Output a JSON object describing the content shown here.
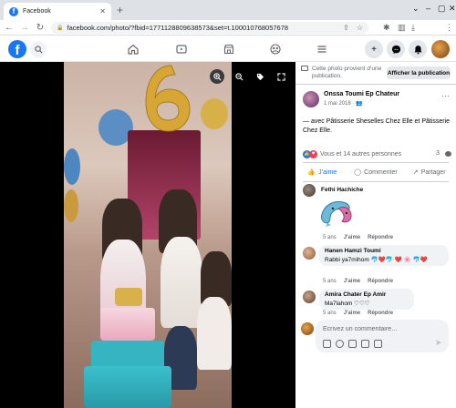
{
  "browser": {
    "tab_title": "Facebook",
    "url": "facebook.com/photo/?fbid=1771128809638573&set=t.100010768057678",
    "icons": [
      "back-icon",
      "forward-icon",
      "reload-icon",
      "lock-icon",
      "share-icon",
      "star-icon",
      "extensions-icon",
      "sidebar-icon",
      "download-icon",
      "profile-icon",
      "more-icon"
    ]
  },
  "facebook_bar": {
    "logo": "f",
    "nav_icons": [
      "home-icon",
      "watch-icon",
      "marketplace-icon",
      "groups-icon",
      "menu-icon"
    ],
    "right_icons": [
      "create-icon",
      "messenger-icon",
      "notifications-icon",
      "account-icon"
    ]
  },
  "panel": {
    "notice": "Cette photo provient d’une publication.",
    "publish_button": "Afficher la publication",
    "author": "Onssa Toumi Ep Chateur",
    "date": "1 mai 2018 ·",
    "caption": "— avec Pâtisserie Sheselles Chez Elle et Pâtisserie Chez Elle.",
    "reactions_text": "Vous et 14 autres personnes",
    "comment_count": "3",
    "actions": {
      "like": "J’aime",
      "comment": "Commenter",
      "share": "Partager"
    },
    "comments": [
      {
        "name": "Fethi Hachiche",
        "text": "",
        "sticker": true,
        "time": "5 ans",
        "like": "J'aime",
        "reply": "Répondre"
      },
      {
        "name": "Hanen Hamzi Toumi",
        "text": "Rabbi ya7mihom 🐬❤️🐬 ❤️ 🌸 🐬❤️",
        "time": "5 ans",
        "like": "J'aime",
        "reply": "Répondre"
      },
      {
        "name": "Amira Chater Ep Amir",
        "text": "Ma7lahom ♡♡♡",
        "time": "5 ans",
        "like": "J'aime",
        "reply": "Répondre"
      }
    ],
    "composer_placeholder": "Écrivez un commentaire…"
  },
  "colors": {
    "facebook_blue": "#1877f2",
    "viewer_background": "#000000",
    "bubble_background": "#f0f2f5",
    "secondary_text": "#65676b"
  }
}
